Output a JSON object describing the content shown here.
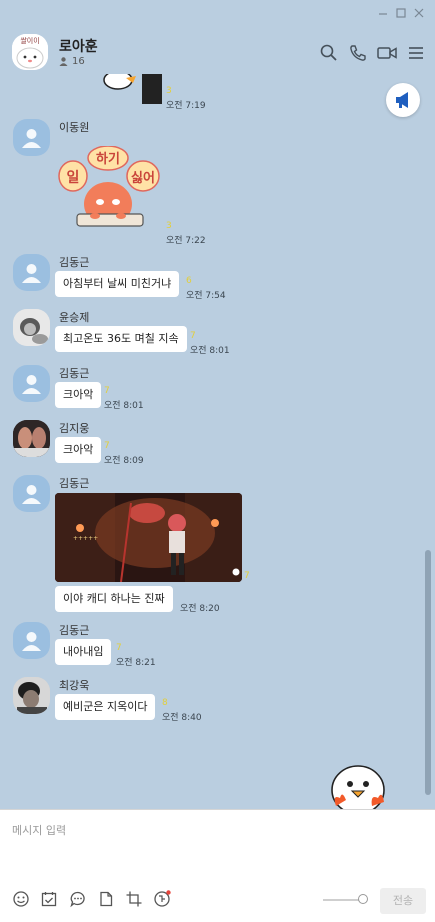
{
  "room": {
    "title": "로아훈",
    "member_count": "16",
    "avatar_text": "쌀이이"
  },
  "messages": [
    {
      "sender": "",
      "unread": "3",
      "time": "오전 7:19"
    },
    {
      "sender": "이동원",
      "sticker": {
        "words": [
          "일",
          "하기",
          "싫어"
        ]
      },
      "unread": "3",
      "time": "오전 7:22"
    },
    {
      "sender": "김동근",
      "text": "아침부터 날씨 미친거냐",
      "unread": "6",
      "time": "오전 7:54"
    },
    {
      "sender": "윤승제",
      "text": "최고온도 36도 며칠 지속",
      "unread": "7",
      "time": "오전 8:01"
    },
    {
      "sender": "김동근",
      "text": "크아악",
      "unread": "7",
      "time": "오전 8:01"
    },
    {
      "sender": "김지웅",
      "text": "크아악",
      "unread": "7",
      "time": "오전 8:09"
    },
    {
      "sender": "김동근",
      "image": {
        "hud_text": "+++++"
      },
      "text": "이야 캐디 하나는 진짜",
      "unread": "7",
      "time": "오전 8:20"
    },
    {
      "sender": "김동근",
      "text": "내아내임",
      "unread": "7",
      "time": "오전 8:21"
    },
    {
      "sender": "최강욱",
      "text": "예비군은 지옥이다",
      "unread": "8",
      "time": "오전 8:40"
    }
  ],
  "compose": {
    "placeholder": "메시지 입력",
    "send_label": "전송"
  },
  "icons": {
    "window": [
      "minimize-icon",
      "maximize-icon",
      "close-icon"
    ],
    "header": [
      "search-icon",
      "phone-icon",
      "video-call-icon",
      "menu-icon"
    ],
    "toolbar": [
      "emoticon-icon",
      "calendar-check-icon",
      "chat-bubble-icon",
      "file-icon",
      "crop-icon",
      "translate-icon"
    ]
  },
  "colors": {
    "background": "#bacee0",
    "bubble": "#ffffff",
    "unread": "#e3cf3a",
    "announce_blue": "#1f5fbf"
  }
}
